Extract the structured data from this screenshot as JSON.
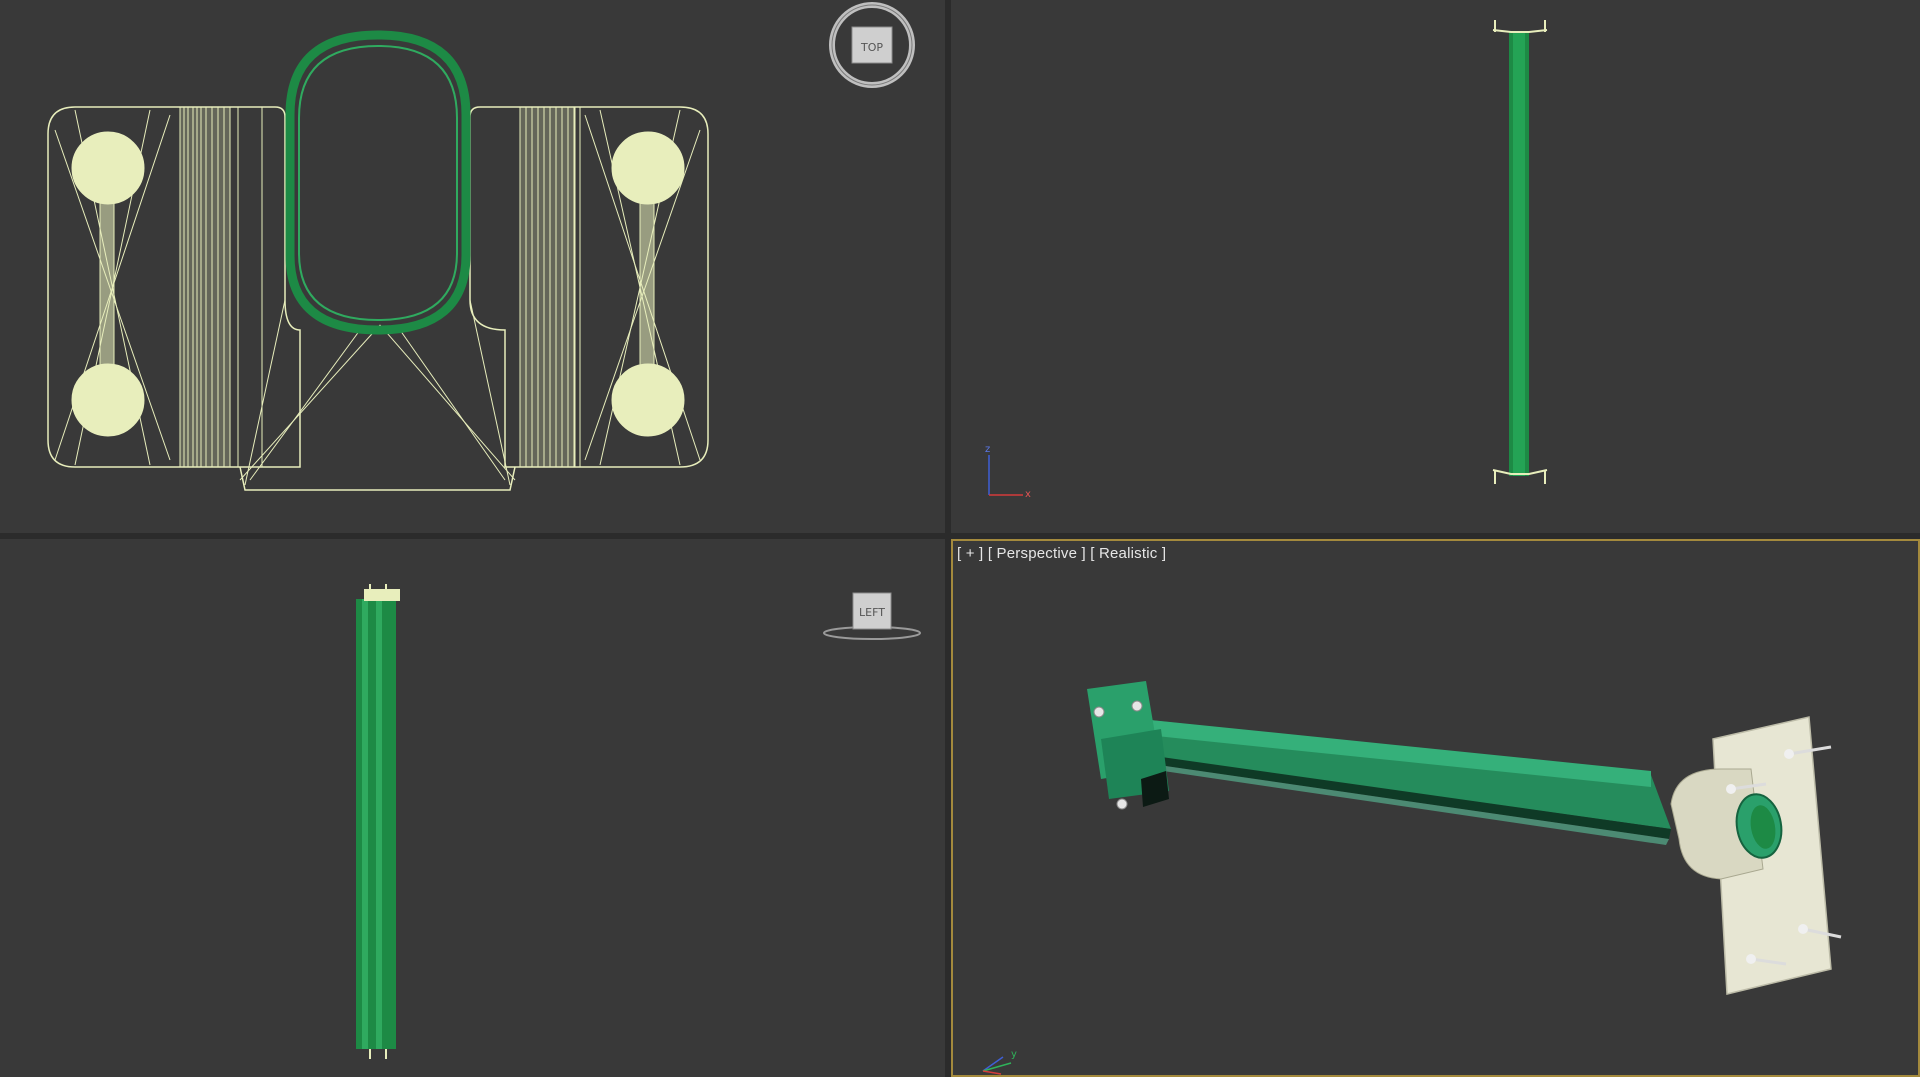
{
  "viewports": {
    "top": {
      "viewcube_label": "TOP"
    },
    "front": {},
    "left": {
      "viewcube_label": "LEFT"
    },
    "perspective": {
      "label_plus": "[ + ]",
      "label_view": "[ Perspective ]",
      "label_shading": "[ Realistic ]",
      "active": true
    }
  },
  "colors": {
    "background": "#393939",
    "active_border": "#a48a3d",
    "wire_green": "#1d8a45",
    "wire_yellow": "#e8eebc",
    "model_green": "#2a9e6a",
    "bracket_cream": "#e7e6d3"
  },
  "axis_tripod": {
    "x": "x",
    "y": "y",
    "z": "z"
  }
}
